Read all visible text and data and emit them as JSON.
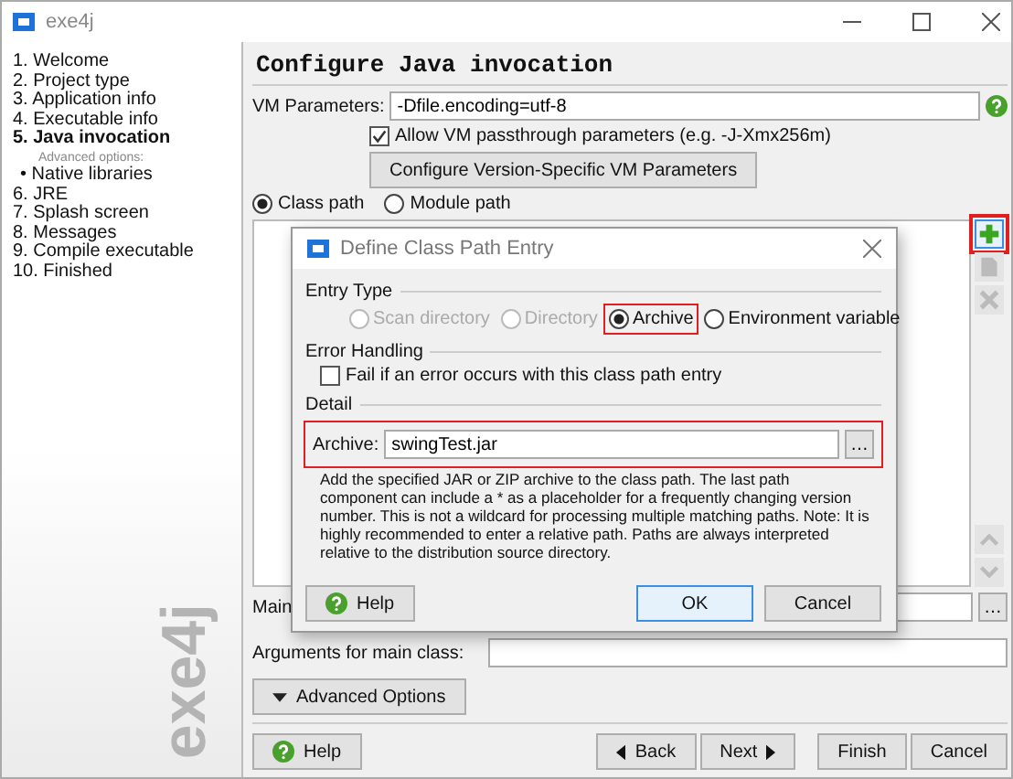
{
  "window": {
    "title": "exe4j",
    "logo": "exe4j"
  },
  "steps": [
    {
      "label": "1. Welcome",
      "selected": false
    },
    {
      "label": "2. Project type",
      "selected": false
    },
    {
      "label": "3. Application info",
      "selected": false
    },
    {
      "label": "4. Executable info",
      "selected": false
    },
    {
      "label": "5. Java invocation",
      "selected": true,
      "caption": "Advanced options:",
      "children": [
        {
          "label": "• Native libraries",
          "selected": false
        }
      ]
    },
    {
      "label": "6. JRE",
      "selected": false
    },
    {
      "label": "7. Splash screen",
      "selected": false
    },
    {
      "label": "8. Messages",
      "selected": false
    },
    {
      "label": "9. Compile executable",
      "selected": false
    },
    {
      "label": "10. Finished",
      "selected": false
    }
  ],
  "page": {
    "heading": "Configure Java invocation",
    "vm_parameters": {
      "label": "VM Parameters:",
      "value": "-Dfile.encoding=utf-8"
    },
    "passthrough": {
      "label": "Allow VM passthrough parameters (e.g. -J-Xmx256m)",
      "checked": true
    },
    "configure_button": "Configure Version-Specific VM Parameters",
    "path_modes": [
      {
        "label": "Class path",
        "selected": true
      },
      {
        "label": "Module path",
        "selected": false
      }
    ],
    "list_tools": [
      {
        "kind": "add",
        "disabled": false,
        "highlighted": true
      },
      {
        "kind": "edit",
        "disabled": true,
        "highlighted": false
      },
      {
        "kind": "remove",
        "disabled": true,
        "highlighted": false
      },
      {
        "kind": "up",
        "disabled": true,
        "highlighted": false
      },
      {
        "kind": "down",
        "disabled": true,
        "highlighted": false
      }
    ],
    "main_class": {
      "label": "Main",
      "browse": "…"
    },
    "arguments": {
      "label": "Arguments for main class:"
    },
    "advanced_button": "Advanced Options"
  },
  "buttons": [
    {
      "label": "Help",
      "kind": "help"
    },
    {
      "label": "Back",
      "kind": "back"
    },
    {
      "label": "Next",
      "kind": "next"
    },
    {
      "label": "Finish",
      "kind": "plain"
    },
    {
      "label": "Cancel",
      "kind": "plain"
    }
  ],
  "dialog": {
    "title": "Define Class Path Entry",
    "entry_type": {
      "caption": "Entry Type",
      "options": [
        {
          "label": "Scan directory",
          "selected": false,
          "disabled": true,
          "highlighted": false
        },
        {
          "label": "Directory",
          "selected": false,
          "disabled": true,
          "highlighted": false
        },
        {
          "label": "Archive",
          "selected": true,
          "disabled": false,
          "highlighted": true
        },
        {
          "label": "Environment variable",
          "selected": false,
          "disabled": false,
          "highlighted": false
        }
      ]
    },
    "error_handling": {
      "caption": "Error Handling",
      "fail_option": {
        "label": "Fail if an error occurs with this class path entry",
        "checked": false
      }
    },
    "detail": {
      "caption": "Detail",
      "archive": {
        "label": "Archive:",
        "value": "swingTest.jar",
        "browse": "…",
        "highlighted": true
      },
      "description": "Add the specified JAR or ZIP archive to the class path. The last path component can include a * as a placeholder for a frequently changing version number. This is not a wildcard for processing multiple matching paths. Note: It is highly recommended to enter a relative path. Paths are always interpreted relative to the distribution source directory."
    },
    "buttons": [
      {
        "label": "Help",
        "kind": "help"
      },
      {
        "label": "OK",
        "kind": "default"
      },
      {
        "label": "Cancel",
        "kind": "plain"
      }
    ]
  }
}
